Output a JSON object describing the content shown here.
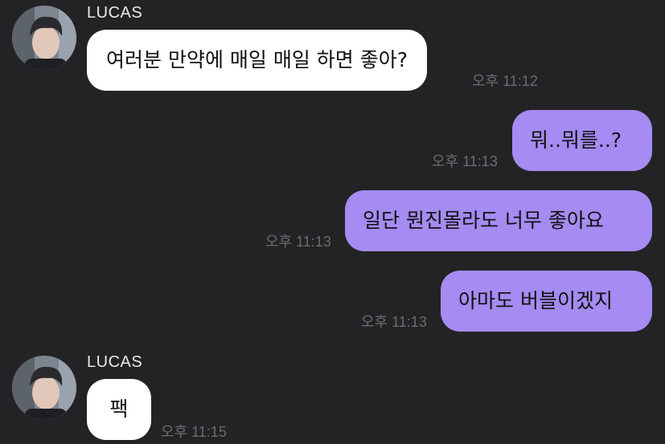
{
  "colors": {
    "background": "#232325",
    "incoming_bubble": "#ffffff",
    "outgoing_bubble": "#a58bf2",
    "timestamp": "#6c6c70",
    "sender_name": "#e9e9e9"
  },
  "messages": [
    {
      "direction": "incoming",
      "sender": "LUCAS",
      "text": "여러분 만약에 매일 매일 하면 좋아?",
      "time": "오후 11:12"
    },
    {
      "direction": "outgoing",
      "text": "뭐..뭐를..?",
      "time": "오후 11:13"
    },
    {
      "direction": "outgoing",
      "text": "일단 뭔진몰라도 너무 좋아요",
      "time": "오후 11:13"
    },
    {
      "direction": "outgoing",
      "text": "아마도 버블이겠지",
      "time": "오후 11:13"
    },
    {
      "direction": "incoming",
      "sender": "LUCAS",
      "text": "팩",
      "time": "오후 11:15"
    }
  ]
}
